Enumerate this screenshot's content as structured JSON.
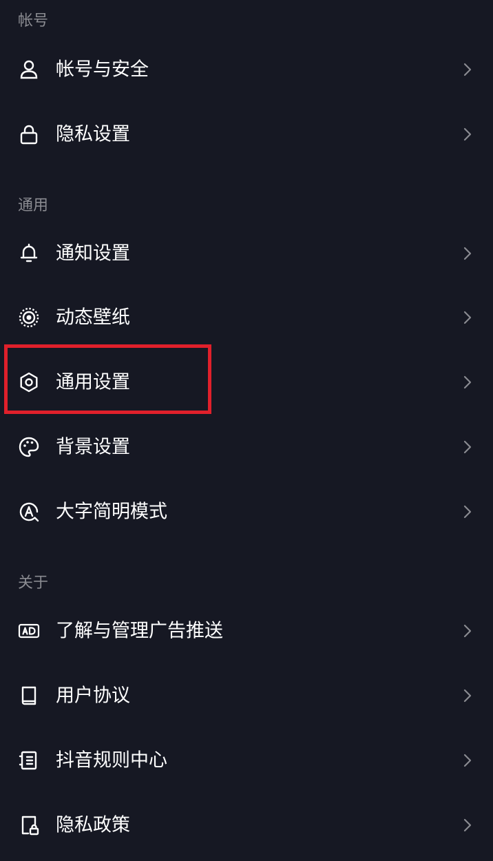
{
  "sections": {
    "account": {
      "title": "帐号",
      "items": [
        {
          "label": "帐号与安全",
          "icon": "user-icon"
        },
        {
          "label": "隐私设置",
          "icon": "lock-icon"
        }
      ]
    },
    "general": {
      "title": "通用",
      "items": [
        {
          "label": "通知设置",
          "icon": "bell-icon"
        },
        {
          "label": "动态壁纸",
          "icon": "live-wallpaper-icon"
        },
        {
          "label": "通用设置",
          "icon": "gear-icon"
        },
        {
          "label": "背景设置",
          "icon": "palette-icon"
        },
        {
          "label": "大字简明模式",
          "icon": "large-font-icon"
        }
      ]
    },
    "about": {
      "title": "关于",
      "items": [
        {
          "label": "了解与管理广告推送",
          "icon": "ad-icon"
        },
        {
          "label": "用户协议",
          "icon": "book-icon"
        },
        {
          "label": "抖音规则中心",
          "icon": "rules-icon"
        },
        {
          "label": "隐私政策",
          "icon": "privacy-policy-icon"
        }
      ]
    }
  },
  "colors": {
    "background": "#161823",
    "text": "#ffffff",
    "section_title": "#8a8b91",
    "chevron": "#8a8b91",
    "highlight": "#e0202b"
  }
}
